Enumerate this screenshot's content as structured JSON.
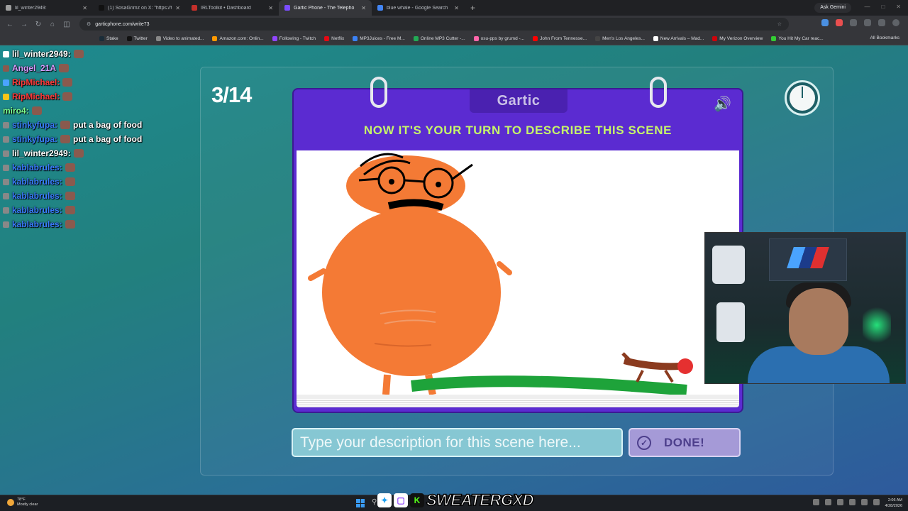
{
  "browser": {
    "tabs": [
      {
        "label": "lil_winter2949:",
        "color": "#9e9e9e"
      },
      {
        "label": "(1) SosaGrimz on X: \"https://t.a",
        "color": "#111111"
      },
      {
        "label": "IRLToolkit • Dashboard",
        "color": "#c4302b"
      },
      {
        "label": "Gartic Phone - The Telepho",
        "color": "#7b4dff"
      },
      {
        "label": "blue whale - Google Search",
        "color": "#4285f4"
      }
    ],
    "new_tab": "+",
    "ask_gemini": "Ask Gemini",
    "url": "garticphone.com/write73",
    "bookmarks": [
      {
        "label": "Stake",
        "color": "#1a2c38"
      },
      {
        "label": "Twitter",
        "color": "#111111"
      },
      {
        "label": "Video to animated...",
        "color": "#888888"
      },
      {
        "label": "Amazon.com: Onlin...",
        "color": "#ff9900"
      },
      {
        "label": "Following - Twitch",
        "color": "#9146ff"
      },
      {
        "label": "Netflix",
        "color": "#e50914"
      },
      {
        "label": "MP3Juices - Free M...",
        "color": "#3b82f6"
      },
      {
        "label": "Online MP3 Cutter -...",
        "color": "#22aa55"
      },
      {
        "label": "osu-pps by grumd -...",
        "color": "#ff66aa"
      },
      {
        "label": "John From Tennesse...",
        "color": "#ff0000"
      },
      {
        "label": "Men's Los Angeles...",
        "color": "#444444"
      },
      {
        "label": "New Arrivals – Mad...",
        "color": "#ffffff"
      },
      {
        "label": "My Verizon Overview",
        "color": "#cd040b"
      },
      {
        "label": "You Hit My Car reac...",
        "color": "#33cc33"
      }
    ],
    "all_bookmarks": "All Bookmarks"
  },
  "chat": [
    {
      "user": "lil_winter2949:",
      "user_class": "u-white",
      "message": "",
      "emote": true,
      "badge": "#ffffff"
    },
    {
      "user": "Angel_21A",
      "user_class": "u-purple",
      "message": "",
      "emote": true,
      "badge": "#8a5a4e"
    },
    {
      "user": "RipMichael:",
      "user_class": "u-red",
      "message": "",
      "emote": true,
      "badge": "#4aa3ff"
    },
    {
      "user": "RipMichael:",
      "user_class": "u-red",
      "message": "",
      "emote": true,
      "badge": "#f5c518"
    },
    {
      "user": "miro4:",
      "user_class": "u-green",
      "message": "",
      "emote": true,
      "badge": ""
    },
    {
      "user": "stinkyfupa:",
      "user_class": "u-blue",
      "message": "put a bag of food",
      "emote": true,
      "badge": "#888888"
    },
    {
      "user": "stinkyfupa:",
      "user_class": "u-blue",
      "message": "put a bag of food",
      "emote": true,
      "badge": "#888888"
    },
    {
      "user": "lil_winter2949:",
      "user_class": "u-white",
      "message": "",
      "emote": true,
      "badge": "#888888"
    },
    {
      "user": "kablabrules:",
      "user_class": "u-blue",
      "message": "",
      "emote": true,
      "badge": "#888888"
    },
    {
      "user": "kablabrules:",
      "user_class": "u-blue",
      "message": "",
      "emote": true,
      "badge": "#888888"
    },
    {
      "user": "kablabrules:",
      "user_class": "u-blue",
      "message": "",
      "emote": true,
      "badge": "#888888"
    },
    {
      "user": "kablabrules:",
      "user_class": "u-blue",
      "message": "",
      "emote": true,
      "badge": "#888888"
    },
    {
      "user": "kablabrules:",
      "user_class": "u-blue",
      "message": "",
      "emote": true,
      "badge": "#888888"
    }
  ],
  "game": {
    "round": "3/14",
    "logo": "Gartic",
    "prompt": "NOW IT'S YOUR TURN TO DESCRIBE THIS SCENE",
    "input_placeholder": "Type your description for this scene here...",
    "input_value": "",
    "done_label": "DONE!",
    "accent": "#5b2bd1",
    "prompt_color": "#c6f56a"
  },
  "overlay": {
    "streamer_name": "SWEATERGXD"
  },
  "taskbar": {
    "weather_temp": "78°F",
    "weather_desc": "Mostly clear",
    "time": "2:06 AM",
    "date": "4/28/2026"
  }
}
